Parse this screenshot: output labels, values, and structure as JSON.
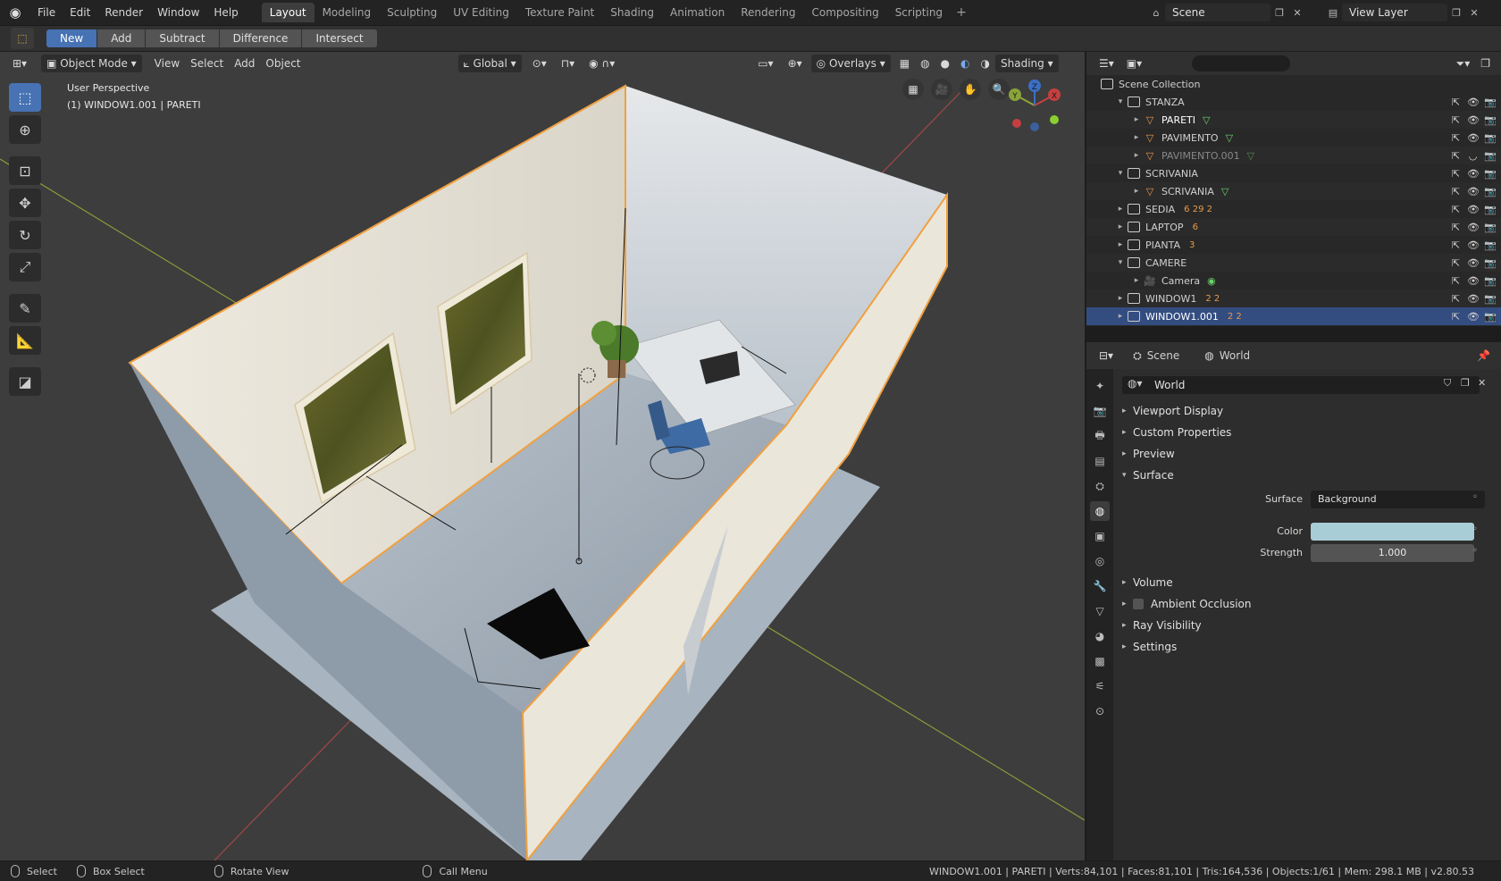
{
  "menubar": {
    "items": [
      "File",
      "Edit",
      "Render",
      "Window",
      "Help"
    ],
    "workspaces": [
      "Layout",
      "Modeling",
      "Sculpting",
      "UV Editing",
      "Texture Paint",
      "Shading",
      "Animation",
      "Rendering",
      "Compositing",
      "Scripting"
    ],
    "active_workspace": "Layout",
    "add_tab": "+",
    "scene_name": "Scene",
    "view_layer": "View Layer"
  },
  "tool_header": {
    "modes": [
      "New",
      "Add",
      "Subtract",
      "Difference",
      "Intersect"
    ],
    "active_mode": "New"
  },
  "viewport": {
    "header": {
      "interaction_mode": "Object Mode",
      "menus": [
        "View",
        "Select",
        "Add",
        "Object"
      ],
      "transform_orientation": "Global",
      "overlays": "Overlays",
      "shading": "Shading"
    },
    "perspective_label": "User Perspective",
    "object_label": "(1) WINDOW1.001 | PARETI",
    "gizmo": {
      "x": "X",
      "y": "Y",
      "z": "Z"
    }
  },
  "outliner": {
    "search_placeholder": "",
    "root": "Scene Collection",
    "rows": [
      {
        "name": "STANZA",
        "type": "collection",
        "indent": 1,
        "expanded": true
      },
      {
        "name": "PARETI",
        "type": "mesh",
        "indent": 2,
        "highlight": true
      },
      {
        "name": "PAVIMENTO",
        "type": "mesh",
        "indent": 2
      },
      {
        "name": "PAVIMENTO.001",
        "type": "mesh",
        "indent": 2,
        "dimmed": true
      },
      {
        "name": "SCRIVANIA",
        "type": "collection",
        "indent": 1,
        "expanded": true
      },
      {
        "name": "SCRIVANIA",
        "type": "mesh",
        "indent": 2
      },
      {
        "name": "SEDIA",
        "type": "collection",
        "indent": 1,
        "badges": "6 29 2"
      },
      {
        "name": "LAPTOP",
        "type": "collection",
        "indent": 1,
        "badges": "6"
      },
      {
        "name": "PIANTA",
        "type": "collection",
        "indent": 1,
        "badges": "3"
      },
      {
        "name": "CAMERE",
        "type": "collection",
        "indent": 1,
        "expanded": true
      },
      {
        "name": "Camera",
        "type": "camera",
        "indent": 2
      },
      {
        "name": "WINDOW1",
        "type": "collection",
        "indent": 1,
        "badges": "2 2"
      },
      {
        "name": "WINDOW1.001",
        "type": "collection",
        "indent": 1,
        "badges": "2 2",
        "selected": true
      }
    ]
  },
  "properties": {
    "breadcrumb_scene": "Scene",
    "breadcrumb_world": "World",
    "world_name": "World",
    "panels": {
      "viewport_display": "Viewport Display",
      "custom_properties": "Custom Properties",
      "preview": "Preview",
      "surface": "Surface",
      "volume": "Volume",
      "ambient_occlusion": "Ambient Occlusion",
      "ray_visibility": "Ray Visibility",
      "settings": "Settings"
    },
    "surface_label": "Surface",
    "surface_value": "Background",
    "color_label": "Color",
    "color_value": "#a8cdd6",
    "strength_label": "Strength",
    "strength_value": "1.000"
  },
  "statusbar": {
    "select": "Select",
    "box_select": "Box Select",
    "rotate_view": "Rotate View",
    "call_menu": "Call Menu",
    "stats": "WINDOW1.001 | PARETI | Verts:84,101 | Faces:81,101 | Tris:164,536 | Objects:1/61 | Mem: 298.1 MB | v2.80.53"
  },
  "colors": {
    "accent": "#4772b3",
    "selection_outline": "#f0a040",
    "selected_row": "#334d80"
  }
}
